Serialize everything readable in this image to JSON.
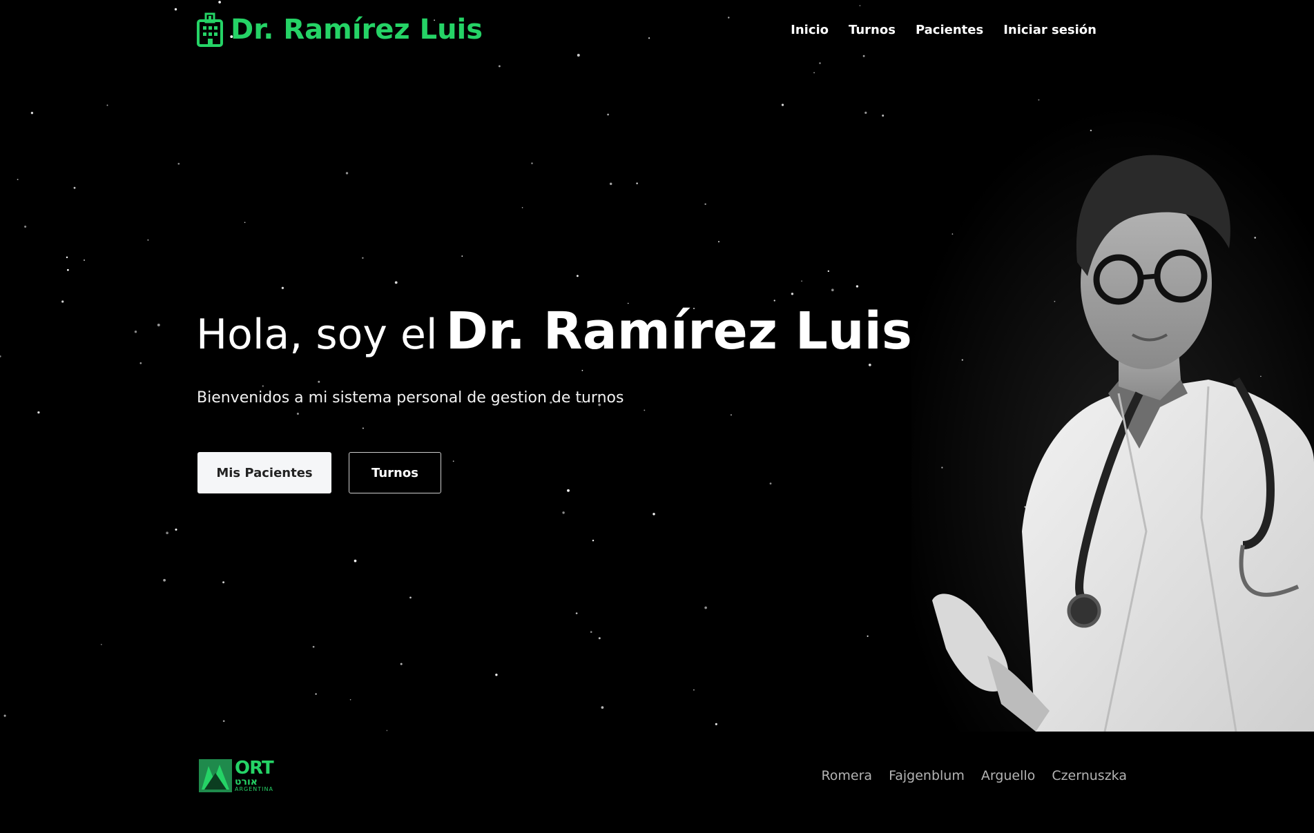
{
  "brand": {
    "icon": "hospital-icon",
    "name": "Dr. Ramírez Luis",
    "color": "#25d366"
  },
  "nav": {
    "items": [
      "Inicio",
      "Turnos",
      "Pacientes",
      "Iniciar sesión"
    ]
  },
  "hero": {
    "greeting": "Hola, soy el",
    "name": "Dr. Ramírez Luis",
    "subtitle": "Bienvenidos a mi sistema personal de gestion de turnos",
    "primary_button": "Mis Pacientes",
    "secondary_button": "Turnos"
  },
  "portrait": {
    "icon": "doctor-portrait"
  },
  "footer": {
    "logo": {
      "icon": "ort-logo",
      "big": "ORT",
      "hebrew": "אורט",
      "country": "ARGENTINA"
    },
    "authors": [
      "Romera",
      "Fajgenblum",
      "Arguello",
      "Czernuszka"
    ]
  },
  "colors": {
    "background": "#000000",
    "accent": "#25d366"
  }
}
